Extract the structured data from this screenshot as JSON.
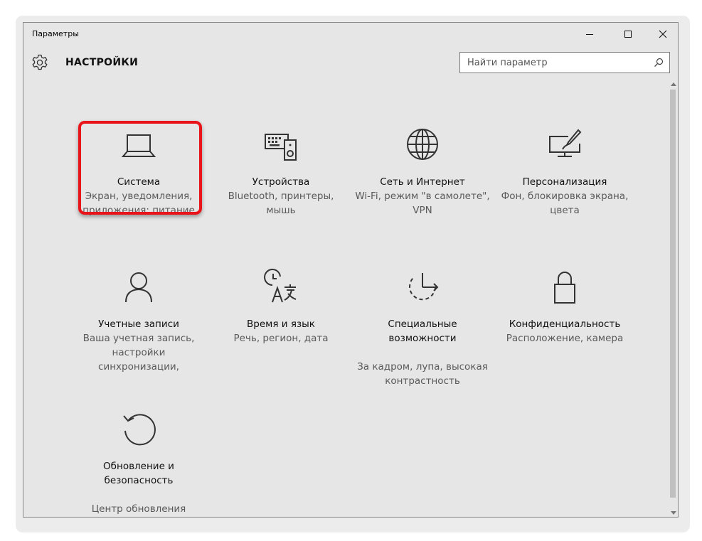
{
  "window": {
    "title": "Параметры",
    "controls": {
      "minimize": "—",
      "maximize": "☐",
      "close": "✕"
    }
  },
  "header": {
    "icon": "gear-icon",
    "title": "НАСТРОЙКИ",
    "search": {
      "placeholder": "Найти параметр",
      "value": "",
      "icon": "search-icon"
    }
  },
  "accent": {
    "highlight": "#e8141a"
  },
  "tiles": [
    {
      "id": "system",
      "icon": "laptop-icon",
      "label": "Система",
      "desc": "Экран, уведомления, приложения; питание",
      "highlighted": true
    },
    {
      "id": "devices",
      "icon": "devices-icon",
      "label": "Устройства",
      "desc": "Bluetooth, принтеры, мышь"
    },
    {
      "id": "network",
      "icon": "globe-icon",
      "label": "Сеть и Интернет",
      "desc": "Wi-Fi, режим \"в самолете\", VPN"
    },
    {
      "id": "personalization",
      "icon": "personalization-icon",
      "label": "Персонализация",
      "desc": "Фон, блокировка экрана, цвета"
    },
    {
      "id": "accounts",
      "icon": "person-icon",
      "label": "Учетные записи",
      "desc": "Ваша учетная запись, настройки синхронизации,"
    },
    {
      "id": "time-language",
      "icon": "time-language-icon",
      "label": "Время и язык",
      "desc": "Речь, регион, дата"
    },
    {
      "id": "ease-of-access",
      "icon": "ease-of-access-icon",
      "label": "Специальные возможности",
      "desc": "За кадром, лупа, высокая контрастность"
    },
    {
      "id": "privacy",
      "icon": "lock-icon",
      "label": "Конфиденциальность",
      "desc": "Расположение, камера"
    },
    {
      "id": "update-security",
      "icon": "update-icon",
      "label": "Обновление и безопасность",
      "desc": "Центр обновления Windows,"
    }
  ]
}
